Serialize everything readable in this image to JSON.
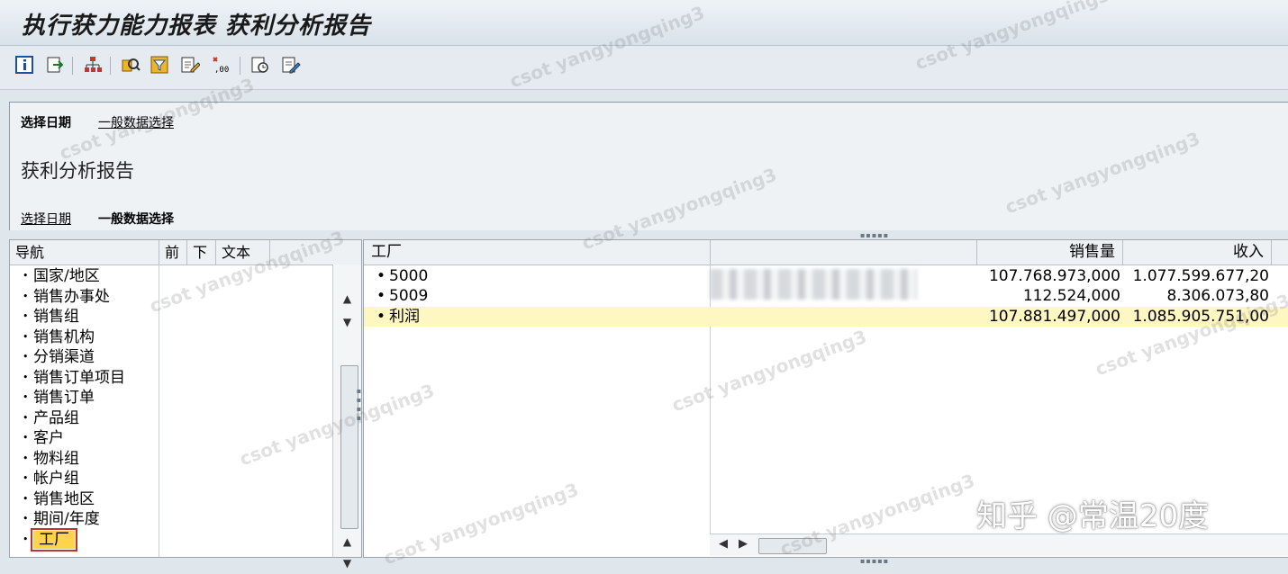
{
  "window": {
    "title": "执行获力能力报表 获利分析报告"
  },
  "toolbar": {
    "icons": [
      "info-icon",
      "export-icon",
      "hierarchy-icon",
      "find-icon",
      "filter-icon",
      "edit-icon",
      "number-format-icon",
      "layout-icon",
      "settings-edit-icon"
    ]
  },
  "selection": {
    "tab_date": "选择日期",
    "tab_general": "一般数据选择",
    "report_title": "获利分析报告"
  },
  "navigation": {
    "headers": {
      "nav": "导航",
      "prev": "前",
      "down": "下",
      "text": "文本"
    },
    "items": [
      {
        "label": "国家/地区"
      },
      {
        "label": "销售办事处"
      },
      {
        "label": "销售组"
      },
      {
        "label": "销售机构"
      },
      {
        "label": "分销渠道"
      },
      {
        "label": "销售订单项目"
      },
      {
        "label": "销售订单"
      },
      {
        "label": "产品组"
      },
      {
        "label": "客户"
      },
      {
        "label": "物料组"
      },
      {
        "label": "帐户组"
      },
      {
        "label": "销售地区"
      },
      {
        "label": "期间/年度"
      },
      {
        "label": "工厂"
      }
    ],
    "selected_index": 13
  },
  "grid": {
    "headers": {
      "plant": "工厂",
      "desc": "",
      "qty": "销售量",
      "revenue": "收入"
    },
    "rows": [
      {
        "plant": "5000",
        "qty": "107.768.973,000",
        "revenue": "1.077.599.677,20"
      },
      {
        "plant": "5009",
        "qty": "112.524,000",
        "revenue": "8.306.073,80"
      },
      {
        "plant": "利润",
        "qty": "107.881.497,000",
        "revenue": "1.085.905.751,00"
      }
    ]
  },
  "watermark": {
    "text": "csot yangyongqing3"
  },
  "overlay": {
    "credit": "知乎 @常温20度"
  },
  "colors": {
    "highlight": "#ffd44a",
    "total_row": "#fff7c2"
  }
}
